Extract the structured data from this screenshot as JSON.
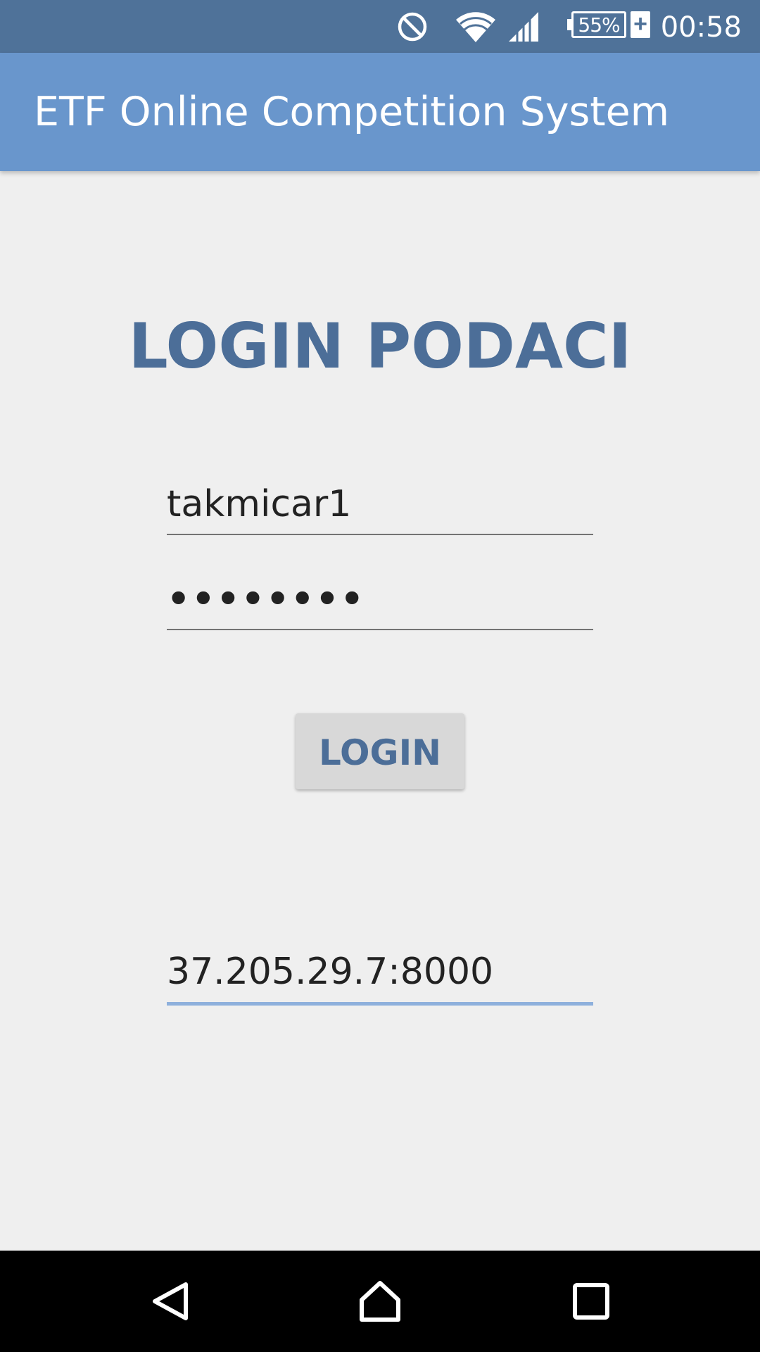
{
  "status_bar": {
    "time": "00:58",
    "battery_percent": "55%",
    "battery_charging_symbol": "+",
    "icons": [
      "do-not-disturb-icon",
      "wifi-icon",
      "cellular-signal-icon",
      "battery-icon"
    ]
  },
  "app_bar": {
    "title": "ETF Online Competition System"
  },
  "login": {
    "heading": "LOGIN PODACI",
    "username": "takmicar1",
    "password_masked": "••••••••",
    "button_label": "LOGIN",
    "server_address": "37.205.29.7:8000"
  },
  "nav_bar": {
    "icons": [
      "back-icon",
      "home-icon",
      "recents-icon"
    ]
  },
  "colors": {
    "status_bar": "#4f7299",
    "app_bar": "#6996cc",
    "accent_text": "#4c6e98",
    "focus_underline": "#8eb0dc",
    "background": "#efefef"
  }
}
